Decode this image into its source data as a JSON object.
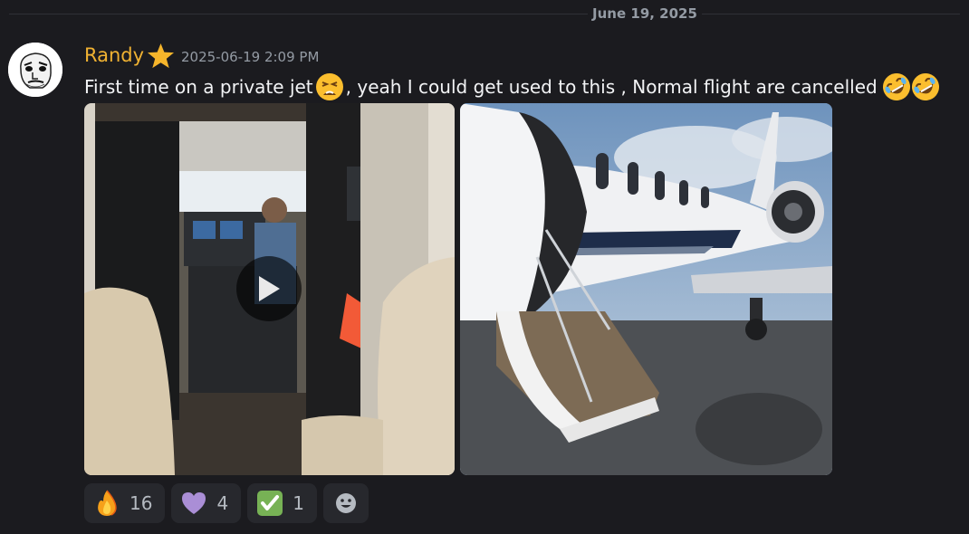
{
  "date_divider": "June 19, 2025",
  "message": {
    "author": "Randy",
    "timestamp": "2025-06-19 2:09 PM",
    "text_part1": "First time on a private jet",
    "text_part2": ", yeah I could get used to this , Normal flight are cancelled",
    "emojis": [
      "weary-face",
      "rolling-on-floor-laughing",
      "rolling-on-floor-laughing"
    ]
  },
  "attachments": [
    {
      "kind": "video",
      "subject": "private-jet-cockpit-interior"
    },
    {
      "kind": "image",
      "subject": "private-jet-airstair-door"
    }
  ],
  "reactions": [
    {
      "emoji": "fire",
      "count": "16"
    },
    {
      "emoji": "purple-heart",
      "count": "4"
    },
    {
      "emoji": "check-mark-button",
      "count": "1"
    }
  ],
  "colors": {
    "background": "#1b1b1f",
    "username": "#f0b232",
    "reaction_bg": "#27282d",
    "muted_text": "#949ba4"
  }
}
